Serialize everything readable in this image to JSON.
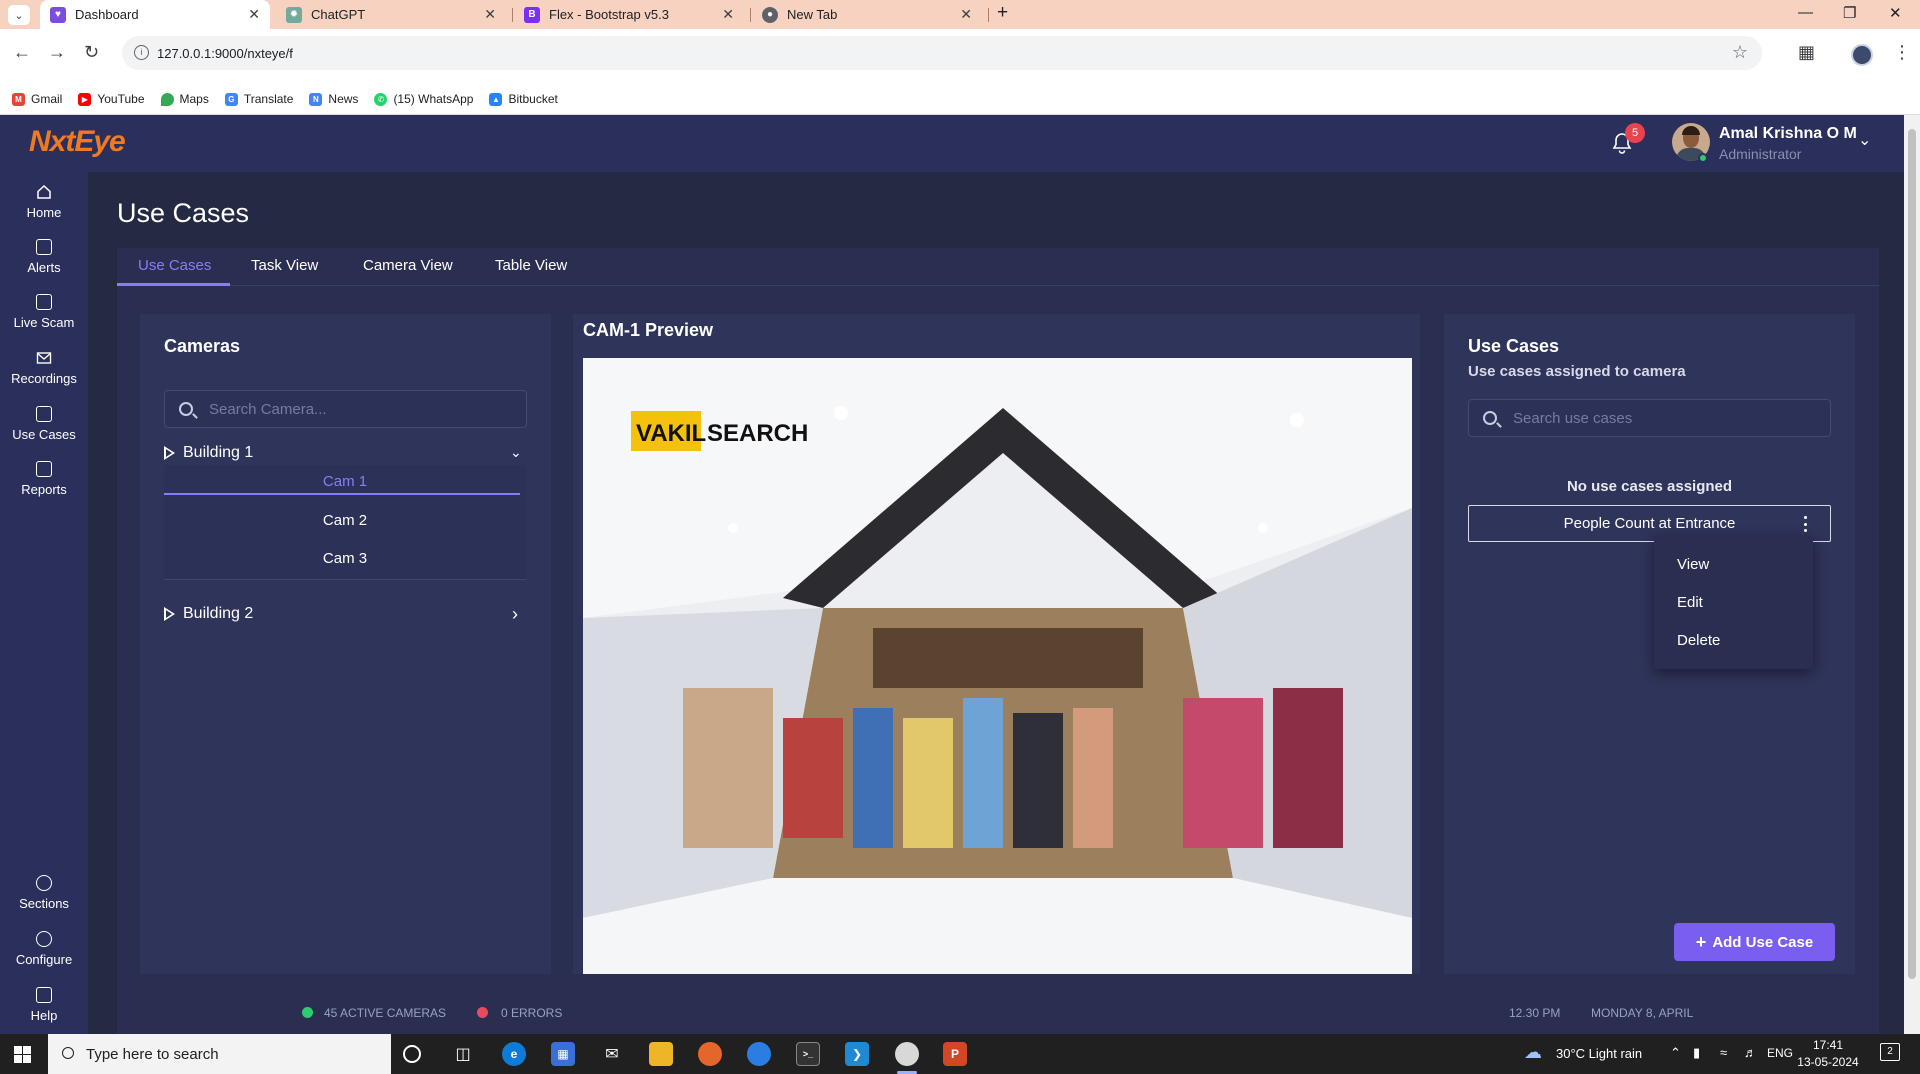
{
  "browser": {
    "tabs": [
      {
        "title": "Dashboard",
        "active": true,
        "favicon_color": "#7b4ce0"
      },
      {
        "title": "ChatGPT",
        "active": false,
        "favicon_color": "#74aa9c"
      },
      {
        "title": "Flex - Bootstrap v5.3",
        "active": false,
        "favicon_color": "#7a2ff2"
      },
      {
        "title": "New Tab",
        "active": false,
        "favicon_color": "#5f6368"
      }
    ],
    "url": "127.0.0.1:9000/nxteye/f",
    "bookmarks": [
      {
        "label": "Gmail",
        "color": "#ea4335"
      },
      {
        "label": "YouTube",
        "color": "#ff0000"
      },
      {
        "label": "Maps",
        "color": "#34a853"
      },
      {
        "label": "Translate",
        "color": "#4285f4"
      },
      {
        "label": "News",
        "color": "#4285f4"
      },
      {
        "label": "(15) WhatsApp",
        "color": "#25d366"
      },
      {
        "label": "Bitbucket",
        "color": "#2684ff"
      }
    ]
  },
  "header": {
    "logo": "NxtEye",
    "notification_count": "5",
    "user_name": "Amal Krishna O M",
    "user_role": "Administrator"
  },
  "sidebar": {
    "items": [
      {
        "label": "Home",
        "icon": "home-icon"
      },
      {
        "label": "Alerts",
        "icon": "alerts-icon"
      },
      {
        "label": "Live Scam",
        "icon": "live-scam-icon"
      },
      {
        "label": "Recordings",
        "icon": "recordings-icon"
      },
      {
        "label": "Use Cases",
        "icon": "use-cases-icon"
      },
      {
        "label": "Reports",
        "icon": "reports-icon"
      },
      {
        "label": "Sections",
        "icon": "sections-icon"
      },
      {
        "label": "Configure",
        "icon": "configure-icon"
      },
      {
        "label": "Help",
        "icon": "help-icon"
      }
    ]
  },
  "page": {
    "title": "Use Cases",
    "tabs": [
      "Use Cases",
      "Task View",
      "Camera View",
      "Table View"
    ],
    "active_tab": "Use Cases"
  },
  "cameras_panel": {
    "title": "Cameras",
    "search_placeholder": "Search Camera...",
    "buildings": [
      {
        "name": "Building 1",
        "expanded": true,
        "cameras": [
          "Cam 1",
          "Cam 2",
          "Cam 3"
        ],
        "selected": "Cam 1"
      },
      {
        "name": "Building 2",
        "expanded": false
      }
    ]
  },
  "preview_panel": {
    "title": "CAM-1 Preview",
    "image_logo_text": "VAKILSEARCH"
  },
  "use_cases_panel": {
    "title": "Use Cases",
    "subtitle": "Use cases assigned to camera",
    "search_placeholder": "Search use cases",
    "empty_message": "No use cases assigned",
    "card_label": "People Count at Entrance",
    "menu": [
      "View",
      "Edit",
      "Delete"
    ],
    "add_button": "Add Use Case"
  },
  "footer": {
    "active_cameras": "45 ACTIVE CAMERAS",
    "errors": "0 ERRORS",
    "time": "12.30 PM",
    "date": "MONDAY 8, APRIL",
    "status_colors": {
      "active": "#2ecc71",
      "error": "#e84a5f"
    }
  },
  "taskbar": {
    "search_placeholder": "Type here to search",
    "weather": "30°C  Light rain",
    "language": "ENG",
    "clock_time": "17:41",
    "clock_date": "13-05-2024",
    "notifications": "2"
  },
  "colors": {
    "accent": "#8a7cf6",
    "button": "#7a5ef0",
    "logo": "#f07a1f",
    "badge": "#e8434f"
  }
}
